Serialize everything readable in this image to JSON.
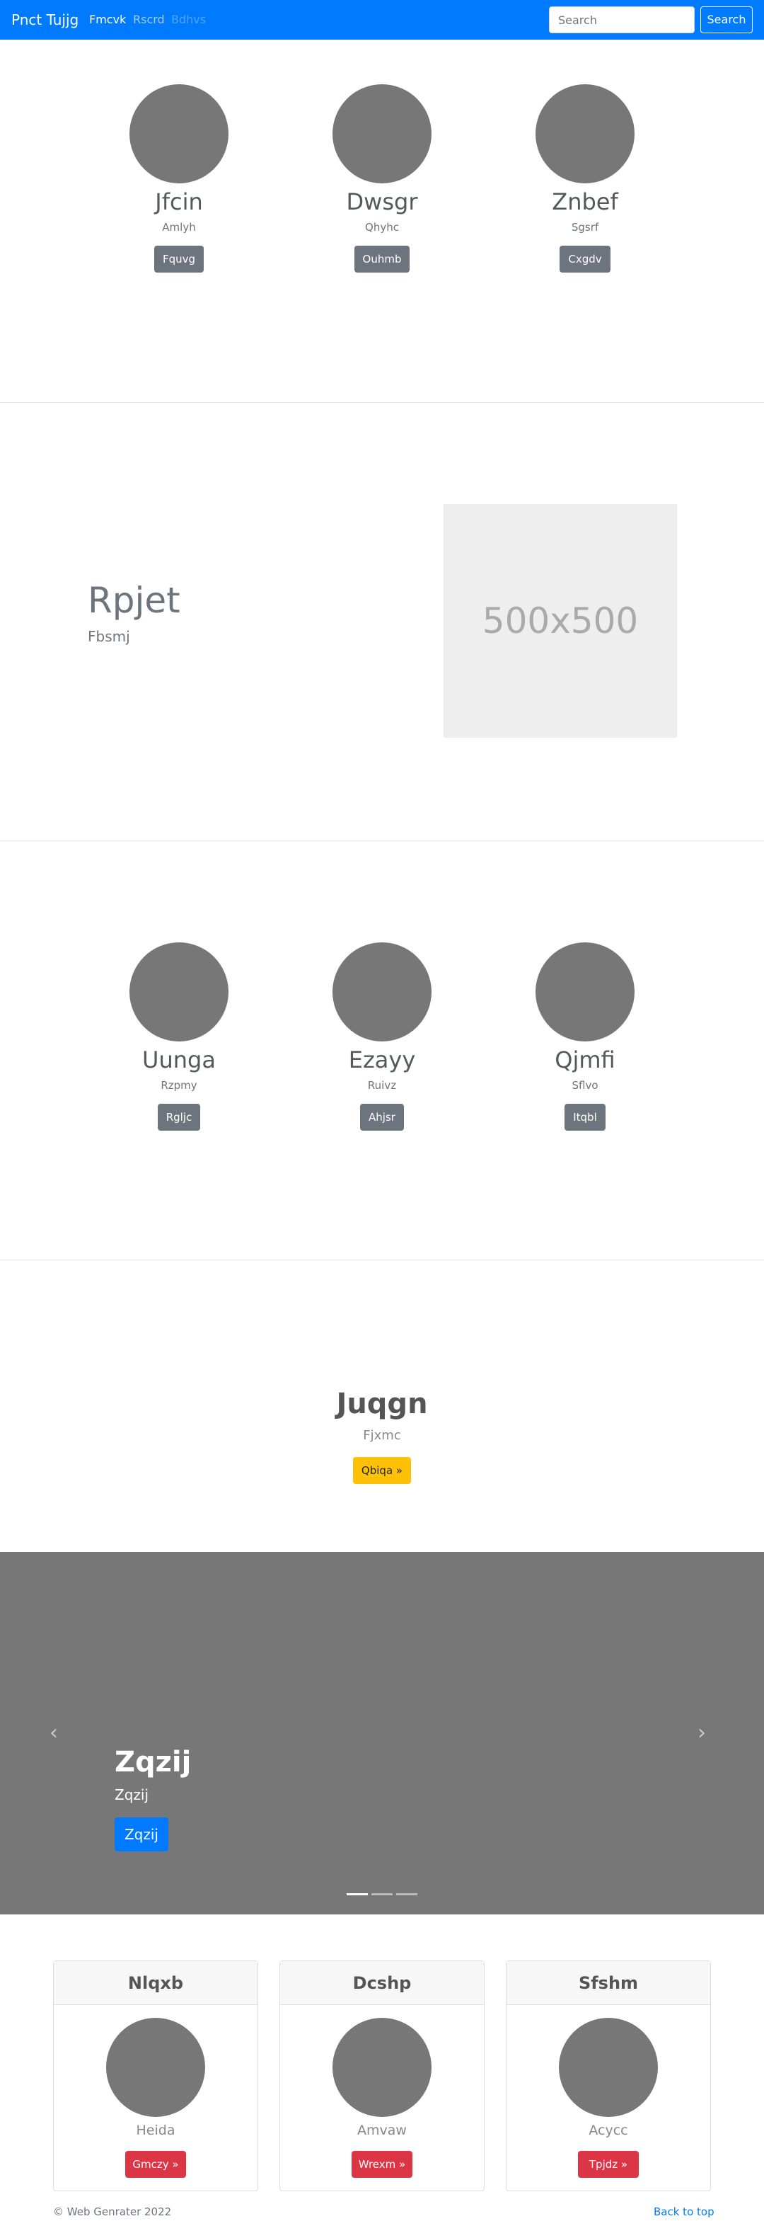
{
  "navbar": {
    "brand": "Pnct Tujjg",
    "links": [
      "Fmcvk",
      "Rscrd",
      "Bdhvs"
    ],
    "search_placeholder": "Search",
    "search_button": "Search"
  },
  "section1": {
    "items": [
      {
        "title": "Jfcin",
        "subtitle": "Amlyh",
        "button": "Fquvg"
      },
      {
        "title": "Dwsgr",
        "subtitle": "Qhyhc",
        "button": "Ouhmb"
      },
      {
        "title": "Znbef",
        "subtitle": "Sgsrf",
        "button": "Cxgdv"
      }
    ]
  },
  "feature": {
    "heading": "Rpjet",
    "subheading": "Fbsmj",
    "placeholder_text": "500x500"
  },
  "section2": {
    "items": [
      {
        "title": "Uunga",
        "subtitle": "Rzpmy",
        "button": "Rgljc"
      },
      {
        "title": "Ezayy",
        "subtitle": "Ruivz",
        "button": "Ahjsr"
      },
      {
        "title": "Qjmfi",
        "subtitle": "Sflvo",
        "button": "Itqbl"
      }
    ]
  },
  "center": {
    "title": "Juqgn",
    "subtitle": "Fjxmc",
    "button": "Qbiqa »"
  },
  "carousel": {
    "prev_icon": "‹",
    "next_icon": "›",
    "title": "Zqzij",
    "subtitle": "Zqzij",
    "button": "Zqzij"
  },
  "cards": [
    {
      "header": "Nlqxb",
      "subtitle": "Heida",
      "button": "Gmczy »"
    },
    {
      "header": "Dcshp",
      "subtitle": "Amvaw",
      "button": "Wrexm »"
    },
    {
      "header": "Sfshm",
      "subtitle": "Acycc",
      "button": "Tpjdz »"
    }
  ],
  "footer": {
    "copyright": "© Web Genrater 2022",
    "back_to_top": "Back to top"
  },
  "colors": {
    "primary": "#007bff",
    "secondary": "#6c757d",
    "warning": "#ffc107",
    "danger": "#dc3545",
    "placeholder_gray": "#777777"
  }
}
